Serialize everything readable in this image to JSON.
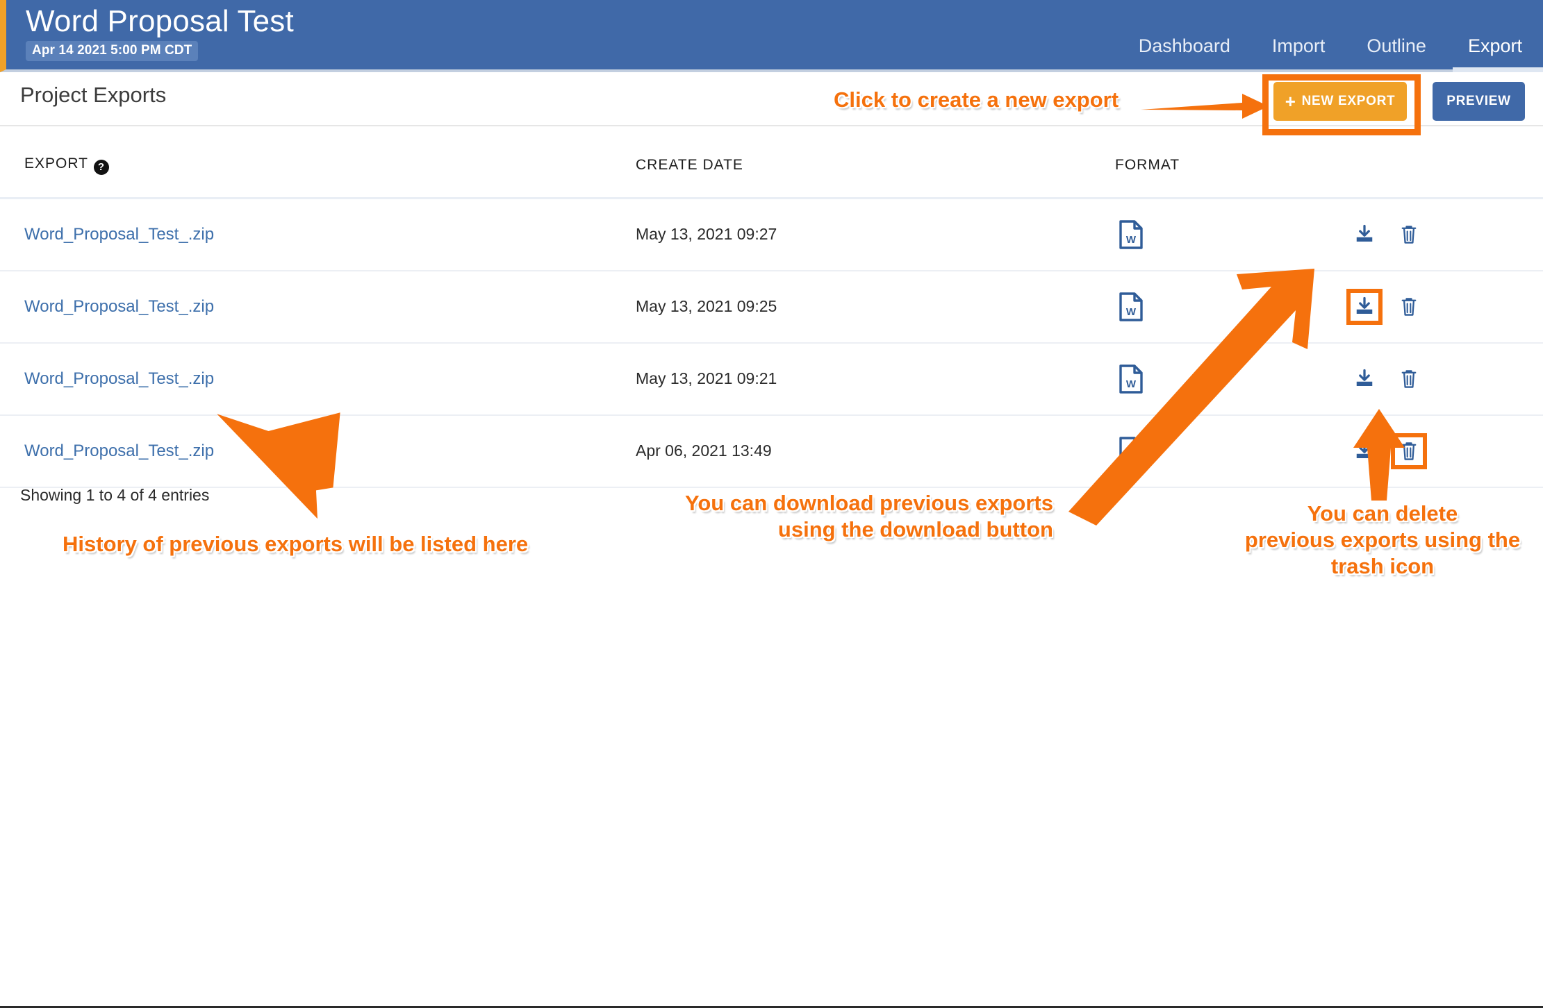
{
  "header": {
    "project_title": "Word Proposal Test",
    "project_date_badge": "Apr 14 2021 5:00 PM CDT",
    "accent_left_border": "#f0a128",
    "background": "#4069a8",
    "nav": [
      {
        "label": "Dashboard",
        "active": false
      },
      {
        "label": "Import",
        "active": false
      },
      {
        "label": "Outline",
        "active": false
      },
      {
        "label": "Export",
        "active": true
      }
    ]
  },
  "toolbar": {
    "page_title": "Project Exports",
    "new_export_label": "NEW EXPORT",
    "new_export_plus": "+",
    "new_export_color": "#f0a128",
    "preview_label": "PREVIEW",
    "preview_color": "#4069a8"
  },
  "table": {
    "columns": [
      "EXPORT",
      "CREATE DATE",
      "FORMAT",
      ""
    ],
    "help_icon_glyph": "?",
    "rows": [
      {
        "name": "Word_Proposal_Test_.zip",
        "create_date": "May 13, 2021 09:27",
        "format_icon": "word-document-icon",
        "format_label": "W",
        "download_highlighted": false,
        "delete_highlighted": false
      },
      {
        "name": "Word_Proposal_Test_.zip",
        "create_date": "May 13, 2021 09:25",
        "format_icon": "word-document-icon",
        "format_label": "W",
        "download_highlighted": true,
        "delete_highlighted": false
      },
      {
        "name": "Word_Proposal_Test_.zip",
        "create_date": "May 13, 2021 09:21",
        "format_icon": "word-document-icon",
        "format_label": "W",
        "download_highlighted": false,
        "delete_highlighted": false
      },
      {
        "name": "Word_Proposal_Test_.zip",
        "create_date": "Apr 06, 2021 13:49",
        "format_icon": "word-document-icon",
        "format_label": "W",
        "download_highlighted": false,
        "delete_highlighted": true
      }
    ],
    "summary": "Showing 1 to 4 of 4 entries"
  },
  "annotations": {
    "accent_color": "#f5710d",
    "new_export": "Click to create a new export",
    "download": "You can download previous exports\nusing the download button",
    "delete": "You can delete\nprevious exports using the\ntrash icon",
    "history": "History of previous exports will be listed here"
  }
}
